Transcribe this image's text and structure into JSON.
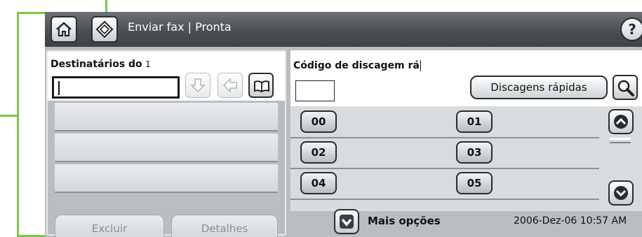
{
  "titlebar": {
    "home_icon": "home-icon",
    "start_icon": "start-diamond-icon",
    "title": "Enviar fax | Pronta",
    "help_label": "?"
  },
  "recipients": {
    "label_bold": "Destinatários do",
    "label_count": "1",
    "input_value": "",
    "add_icon": "arrow-down-icon",
    "back_icon": "arrow-left-icon",
    "book_icon": "address-book-icon",
    "rows": [
      "",
      "",
      ""
    ],
    "delete_label": "Excluir",
    "details_label": "Detalhes"
  },
  "speed_dial": {
    "label": "Código de discagem rá",
    "input_value": "",
    "button_label": "Discagens rápidas",
    "search_icon": "magnifier-icon",
    "codes": [
      "00",
      "01",
      "02",
      "03",
      "04",
      "05"
    ],
    "scroll_up_icon": "chevron-up-icon",
    "scroll_down_icon": "chevron-down-icon"
  },
  "footer": {
    "more_icon": "chevron-down-icon",
    "more_label": "Mais opções",
    "datetime": "2006-Dez-06  10:57 AM"
  },
  "colors": {
    "callout": "#7ac943",
    "titlebar": "#4a4f53",
    "panel_bg": "#b9bec3"
  }
}
